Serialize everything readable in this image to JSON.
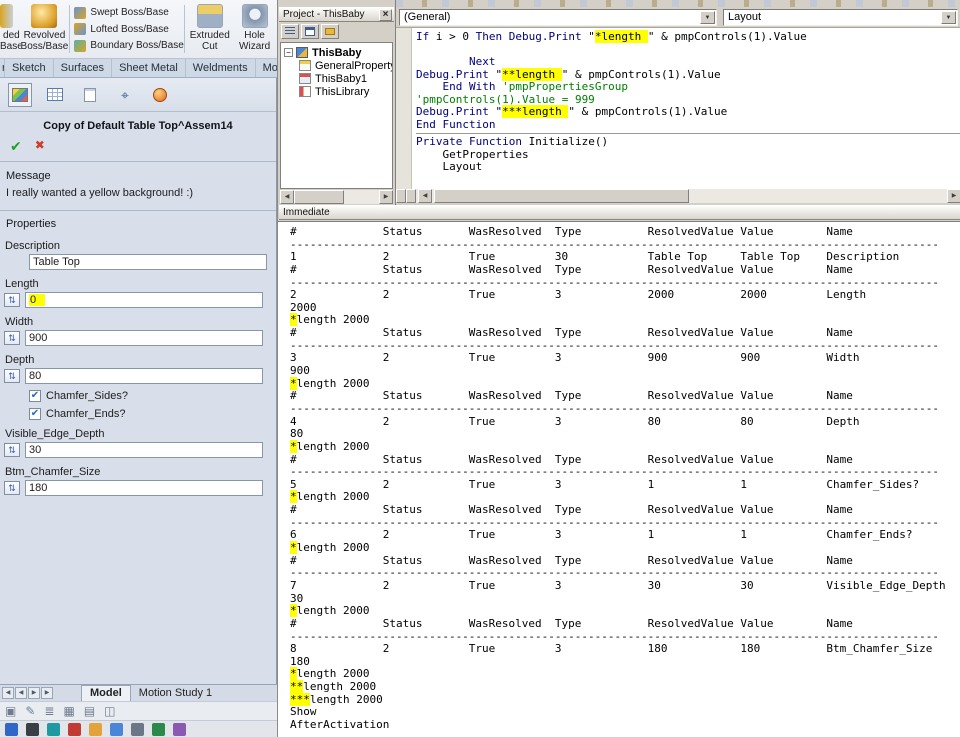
{
  "colors": {
    "highlight": "#ffff00",
    "keyword": "#000080",
    "comment": "#008000",
    "confirm_green": "#1fa12e",
    "cancel_red": "#d23b2a",
    "checkbox_blue": "#2f64c2"
  },
  "icons": {
    "confirm": "✔",
    "cancel": "✖",
    "check": "✔",
    "close": "×",
    "combo_arrow": "▼",
    "scroll_left": "◀",
    "scroll_right": "▶",
    "collapse": "−",
    "number_field": "⇅",
    "crosshair": "⌖",
    "tools": [
      "▣",
      "✎",
      "≣",
      "▦",
      "▤",
      "◫"
    ]
  },
  "sw": {
    "ribbon": {
      "partial_button": {
        "line1": "ded",
        "line2": "Base"
      },
      "revolved": {
        "line1": "Revolved",
        "line2": "Boss/Base"
      },
      "swept": "Swept Boss/Base",
      "lofted": "Lofted Boss/Base",
      "boundary": "Boundary Boss/Base",
      "extruded_cut": {
        "line1": "Extruded",
        "line2": "Cut"
      },
      "hole_wizard": {
        "line1": "Hole",
        "line2": "Wizard"
      }
    },
    "tabs": [
      "res",
      "Sketch",
      "Surfaces",
      "Sheet Metal",
      "Weldments",
      "Mold To"
    ],
    "pm": {
      "title": "Copy of Default Table Top^Assem14",
      "message_header": "Message",
      "message_text": "I really wanted a yellow background! :)",
      "properties_header": "Properties",
      "description_label": "Description",
      "description_value": "Table Top",
      "length_label": "Length",
      "length_value": "0",
      "width_label": "Width",
      "width_value": "900",
      "depth_label": "Depth",
      "depth_value": "80",
      "chamfer_sides_label": "Chamfer_Sides?",
      "chamfer_ends_label": "Chamfer_Ends?",
      "visible_edge_depth_label": "Visible_Edge_Depth",
      "visible_edge_depth_value": "30",
      "btm_chamfer_size_label": "Btm_Chamfer_Size",
      "btm_chamfer_size_value": "180"
    },
    "bottom_tabs": {
      "model": "Model",
      "motion": "Motion Study 1"
    }
  },
  "vbe": {
    "project": {
      "title": "Project - ThisBaby",
      "root": "ThisBaby",
      "items": [
        "GeneralProperty",
        "ThisBaby1",
        "ThisLibrary"
      ]
    },
    "code": {
      "combo_left": "(General)",
      "combo_right": "Layout",
      "lines": [
        {
          "seg": [
            [
              "If",
              "k"
            ],
            [
              " i > 0 ",
              "n"
            ],
            [
              "Then",
              "k"
            ],
            [
              " ",
              "n"
            ],
            [
              "Debug.Print",
              "k"
            ],
            [
              " \"",
              "n"
            ],
            [
              "*length ",
              "h"
            ],
            [
              "\" & pmpControls(1).Value",
              "n"
            ]
          ]
        },
        {
          "seg": []
        },
        {
          "seg": [
            [
              "        ",
              "n"
            ],
            [
              "Next",
              "k"
            ]
          ]
        },
        {
          "seg": [
            [
              "Debug.Print",
              "k"
            ],
            [
              " \"",
              "n"
            ],
            [
              "**length ",
              "h"
            ],
            [
              "\" & pmpControls(1).Value",
              "n"
            ]
          ]
        },
        {
          "seg": [
            [
              "    ",
              "n"
            ],
            [
              "End With",
              "k"
            ],
            [
              " ",
              "n"
            ],
            [
              "'pmpPropertiesGroup",
              "c"
            ]
          ]
        },
        {
          "seg": [
            [
              "'pmpControls(1).Value = 999",
              "c"
            ]
          ]
        },
        {
          "seg": [
            [
              "Debug.Print",
              "k"
            ],
            [
              " \"",
              "n"
            ],
            [
              "***length ",
              "h"
            ],
            [
              "\" & pmpControls(1).Value",
              "n"
            ]
          ]
        },
        {
          "seg": [
            [
              "End Function",
              "k"
            ]
          ],
          "sep": true
        },
        {
          "seg": [
            [
              "Private Function",
              "k"
            ],
            [
              " Initialize()",
              "n"
            ]
          ]
        },
        {
          "seg": [
            [
              "    GetProperties",
              "n"
            ]
          ]
        },
        {
          "seg": [
            [
              "    Layout",
              "n"
            ]
          ]
        }
      ]
    },
    "immediate": {
      "title": "Immediate",
      "columns": [
        "#",
        "Status",
        "WasResolved",
        "Type",
        "ResolvedValue",
        "Value",
        "Name"
      ],
      "column_positions": [
        0,
        14,
        27,
        40,
        54,
        68,
        81
      ],
      "dash_count": 98,
      "star_suffix": "length 2000",
      "blocks": [
        {
          "row": [
            "1",
            "2",
            "True",
            "30",
            "Table Top",
            "Table Top",
            "Description"
          ],
          "echo": null,
          "stars": 0
        },
        {
          "row": [
            "2",
            "2",
            "True",
            "3",
            "2000",
            "2000",
            "Length"
          ],
          "echo": "2000",
          "stars": 1
        },
        {
          "row": [
            "3",
            "2",
            "True",
            "3",
            "900",
            "900",
            "Width"
          ],
          "echo": "900",
          "stars": 1
        },
        {
          "row": [
            "4",
            "2",
            "True",
            "3",
            "80",
            "80",
            "Depth"
          ],
          "echo": "80",
          "stars": 1
        },
        {
          "row": [
            "5",
            "2",
            "True",
            "3",
            "1",
            "1",
            "Chamfer_Sides?"
          ],
          "echo": null,
          "stars": 1
        },
        {
          "row": [
            "6",
            "2",
            "True",
            "3",
            "1",
            "1",
            "Chamfer_Ends?"
          ],
          "echo": null,
          "stars": 1
        },
        {
          "row": [
            "7",
            "2",
            "True",
            "3",
            "30",
            "30",
            "Visible_Edge_Depth"
          ],
          "echo": "30",
          "stars": 1
        },
        {
          "row": [
            "8",
            "2",
            "True",
            "3",
            "180",
            "180",
            "Btm_Chamfer_Size"
          ],
          "echo": "180",
          "stars": 1
        }
      ],
      "tail": [
        {
          "stars": 2,
          "text": "length 2000"
        },
        {
          "stars": 3,
          "text": "length 2000"
        },
        {
          "stars": 0,
          "text": "Show"
        },
        {
          "stars": 0,
          "text": "AfterActivation"
        }
      ]
    }
  }
}
